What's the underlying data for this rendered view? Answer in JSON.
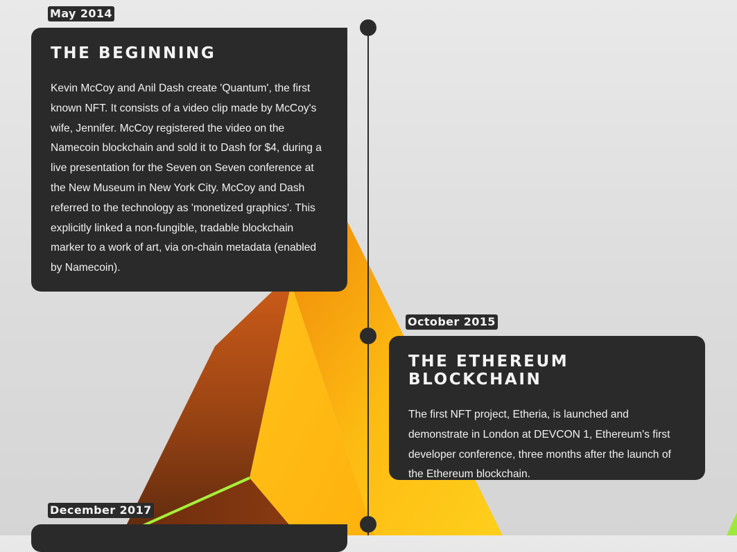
{
  "timeline": {
    "entries": [
      {
        "date": "May 2014",
        "title": "THE BEGINNING",
        "body": "Kevin McCoy and Anil Dash create 'Quantum', the first known NFT. It consists of a video clip made by McCoy's wife, Jennifer. McCoy registered the video on the Namecoin blockchain and sold it to Dash for $4, during a live presentation for the Seven on Seven conference at the New Museum in New York City. McCoy and Dash referred to the technology as 'monetized graphics'. This explicitly linked a non-fungible, tradable blockchain marker to a work of art, via on-chain metadata (enabled by Namecoin)."
      },
      {
        "date": "October 2015",
        "title": "THE ETHEREUM BLOCKCHAIN",
        "body": "The first NFT project, Etheria, is launched and demonstrate in London at DEVCON 1, Ethereum's first developer conference, three months after the launch of the Ethereum blockchain."
      },
      {
        "date": "December 2017",
        "title": "",
        "body": ""
      }
    ]
  },
  "colors": {
    "card_background": "#2a2a2a",
    "text": "#f1f1f1",
    "timeline": "#2b2b2b",
    "shape_orange": "#f59a0c",
    "shape_yellow": "#ffc70f",
    "shape_dark_face": "#8a3a12",
    "shape_green_edge": "#a6f03a"
  },
  "icons": {
    "background": "orange-tetrahedron-graphic"
  }
}
